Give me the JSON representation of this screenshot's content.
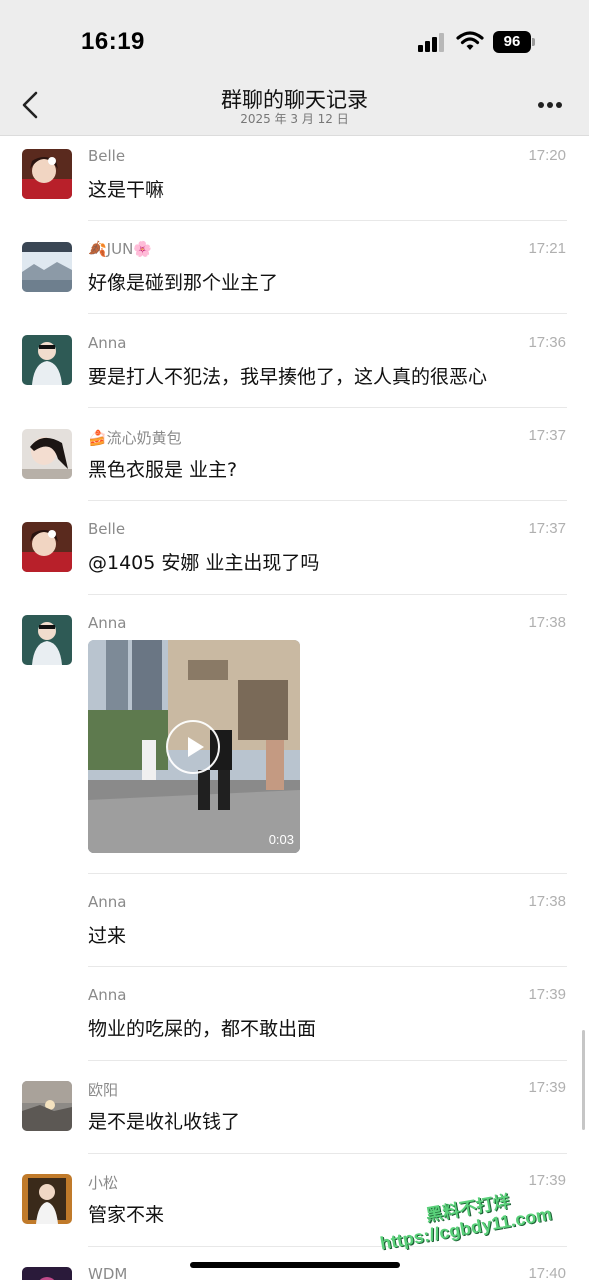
{
  "status_bar": {
    "time": "16:19",
    "battery": "96"
  },
  "nav": {
    "title": "群聊的聊天记录",
    "subtitle": "2025 年 3 月 12 日"
  },
  "messages": [
    {
      "sender": "Belle",
      "time": "17:20",
      "text": "这是干嘛"
    },
    {
      "sender": "🍂JUN🌸",
      "time": "17:21",
      "text": "好像是碰到那个业主了"
    },
    {
      "sender": "Anna",
      "time": "17:36",
      "text": "要是打人不犯法，我早揍他了，这人真的很恶心"
    },
    {
      "sender": "🍰流心奶黄包",
      "time": "17:37",
      "text": "黑色衣服是 业主?"
    },
    {
      "sender": "Belle",
      "time": "17:37",
      "text": "@1405 安娜 业主出现了吗"
    },
    {
      "sender": "Anna",
      "time": "17:38",
      "video_duration": "0:03"
    },
    {
      "sender": "Anna",
      "time": "17:38",
      "text": "过来"
    },
    {
      "sender": "Anna",
      "time": "17:39",
      "text": "物业的吃屎的，都不敢出面"
    },
    {
      "sender": "欧阳",
      "time": "17:39",
      "text": "是不是收礼收钱了"
    },
    {
      "sender": "小松",
      "time": "17:39",
      "text": "管家不来"
    },
    {
      "sender": "WDM",
      "time": "17:40"
    }
  ],
  "watermark": {
    "line1": "黑料不打烊",
    "line2": "https://cgbdy11.com"
  }
}
